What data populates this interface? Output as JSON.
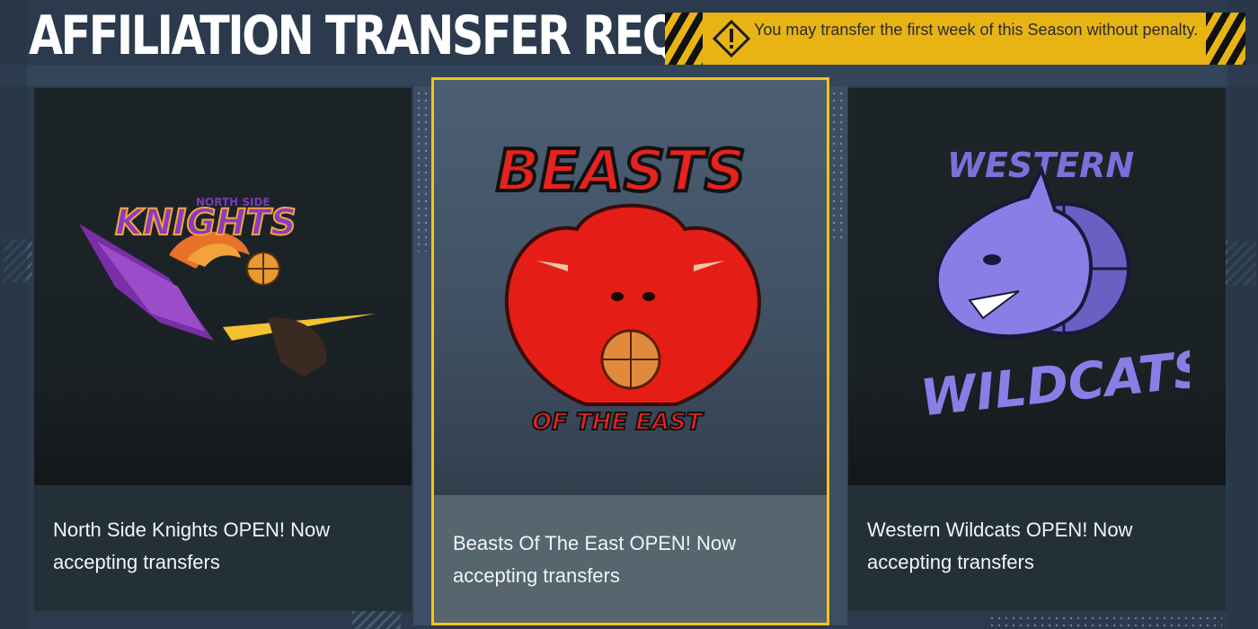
{
  "header": {
    "title": "AFFILIATION TRANSFER REQUEST"
  },
  "notice": {
    "icon": "warning-diamond-icon",
    "text": "You may transfer the first week of this Season without penalty."
  },
  "cards": [
    {
      "logo_name": "north-side-knights-logo",
      "logo_text": [
        "NORTH SIDE",
        "KNIGHTS"
      ],
      "caption": "North Side Knights OPEN! Now accepting transfers"
    },
    {
      "logo_name": "beasts-of-the-east-logo",
      "logo_text": [
        "BEASTS",
        "OF THE EAST"
      ],
      "caption": "Beasts Of The East OPEN! Now accepting transfers",
      "selected": true
    },
    {
      "logo_name": "western-wildcats-logo",
      "logo_text": [
        "WESTERN",
        "WILDCATS"
      ],
      "caption": "Western Wildcats OPEN! Now accepting transfers"
    }
  ],
  "colors": {
    "accent": "#f3c318",
    "notice_bg": "#e8b414",
    "card_bg": "#1a2227",
    "selected_caption_bg": "#57656f"
  }
}
